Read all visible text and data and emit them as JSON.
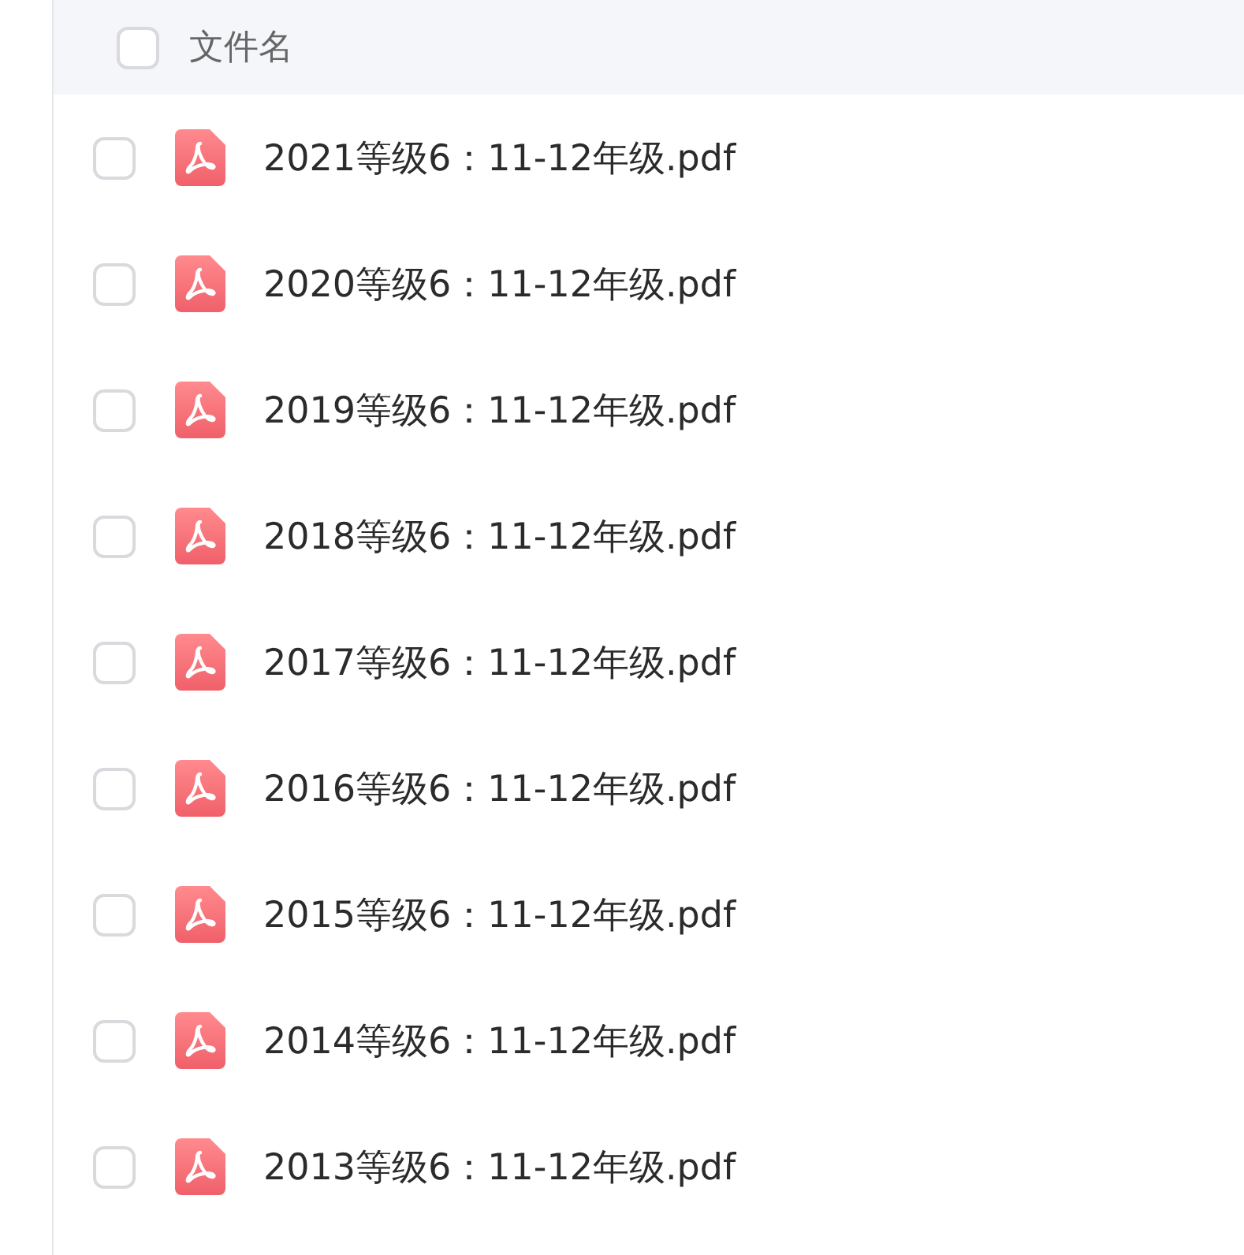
{
  "header": {
    "column_label": "文件名",
    "checked": false
  },
  "files": [
    {
      "name": "2021等级6：11-12年级.pdf",
      "checked": false
    },
    {
      "name": "2020等级6：11-12年级.pdf",
      "checked": false
    },
    {
      "name": "2019等级6：11-12年级.pdf",
      "checked": false
    },
    {
      "name": "2018等级6：11-12年级.pdf",
      "checked": false
    },
    {
      "name": "2017等级6：11-12年级.pdf",
      "checked": false
    },
    {
      "name": "2016等级6：11-12年级.pdf",
      "checked": false
    },
    {
      "name": "2015等级6：11-12年级.pdf",
      "checked": false
    },
    {
      "name": "2014等级6：11-12年级.pdf",
      "checked": false
    },
    {
      "name": "2013等级6：11-12年级.pdf",
      "checked": false
    }
  ]
}
